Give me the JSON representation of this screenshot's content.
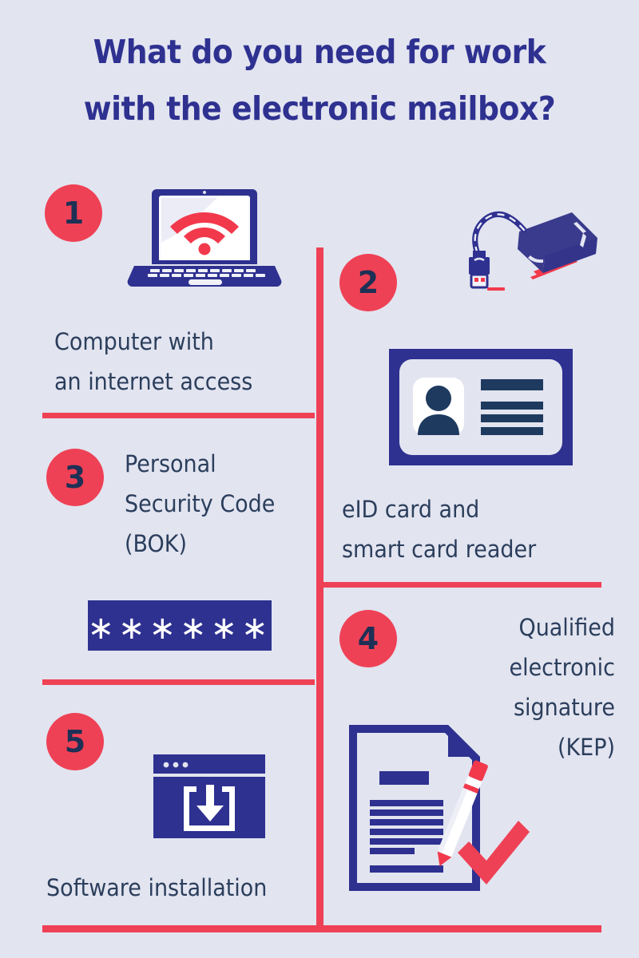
{
  "poster": {
    "title": "What do you need for work\nwith the electronic mailbox?",
    "background_color": "#E2E4F0",
    "accent_red": "#EF4155",
    "accent_navy": "#2E3190",
    "text_color": "#2B3E5C"
  },
  "steps": [
    {
      "number": "1",
      "caption": "Computer with\nan internet access",
      "icon": "laptop-wifi-icon"
    },
    {
      "number": "2",
      "caption": "eID card and\nsmart card reader",
      "icon": "id-card-icon",
      "icon_secondary": "usb-card-reader-icon"
    },
    {
      "number": "3",
      "caption": "Personal\nSecurity Code\n(BOK)",
      "icon": "password-field-icon",
      "password_mask": "∗∗∗∗∗∗"
    },
    {
      "number": "4",
      "caption": "Qualified\nelectronic\nsignature\n(KEP)",
      "icon": "signed-document-icon"
    },
    {
      "number": "5",
      "caption": "Software installation",
      "icon": "browser-download-icon"
    }
  ]
}
